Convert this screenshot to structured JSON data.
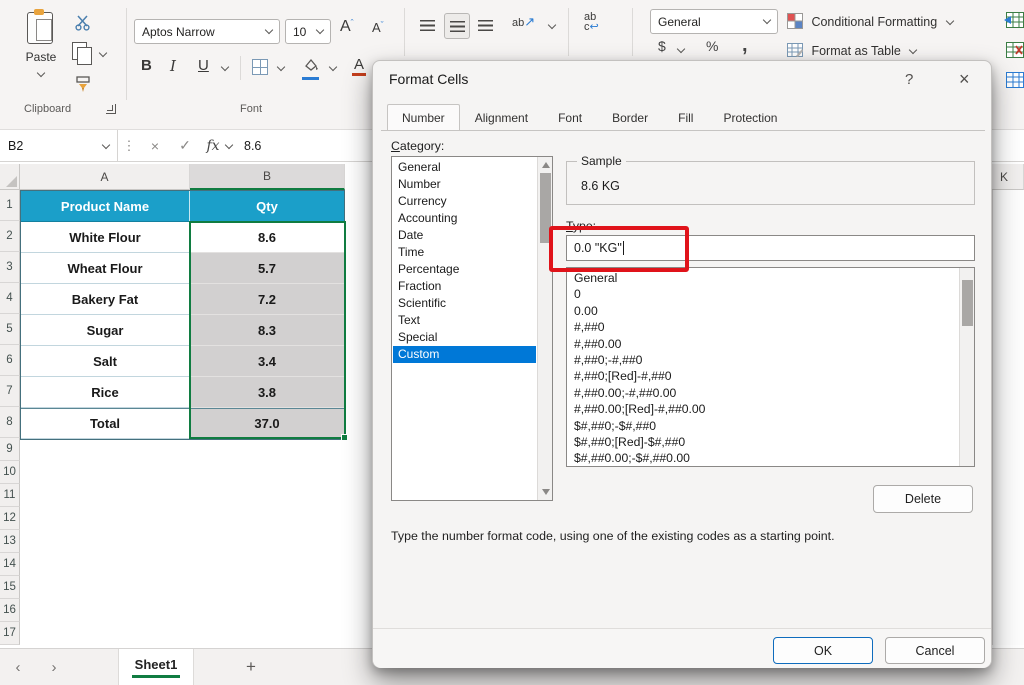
{
  "ribbon": {
    "clipboard": {
      "paste": "Paste",
      "group": "Clipboard"
    },
    "font": {
      "name": "Aptos Narrow",
      "size": "10",
      "grow": "A",
      "shrink": "A",
      "bold": "B",
      "italic": "I",
      "underline": "U",
      "font_color": "A",
      "group": "Font"
    },
    "alignment": {
      "orientation_glyph": "ab",
      "orientation_arrow": "↗",
      "wrap_top": "ab",
      "wrap_bottom": "c",
      "wrap_arrow": "↩"
    },
    "number": {
      "format": "General",
      "currency": "$",
      "percent": "%",
      "comma": ","
    },
    "styles": {
      "conditional_formatting": "Conditional Formatting",
      "format_as_table": "Format as Table"
    }
  },
  "formula_bar": {
    "name_box": "B2",
    "dots": "⋮",
    "cancel_glyph": "×",
    "enter_glyph": "✓",
    "fx": "fx",
    "value": "8.6"
  },
  "sheet": {
    "columns": {
      "a": "A",
      "b": "B",
      "far": "K"
    },
    "row_numbers": [
      "1",
      "2",
      "3",
      "4",
      "5",
      "6",
      "7",
      "8",
      "9",
      "10",
      "11",
      "12",
      "13",
      "14",
      "15",
      "16",
      "17"
    ],
    "table": {
      "header": [
        "Product Name",
        "Qty"
      ],
      "rows": [
        {
          "name": "White Flour",
          "qty": "8.6"
        },
        {
          "name": "Wheat Flour",
          "qty": "5.7"
        },
        {
          "name": "Bakery Fat",
          "qty": "7.2"
        },
        {
          "name": "Sugar",
          "qty": "8.3"
        },
        {
          "name": "Salt",
          "qty": "3.4"
        },
        {
          "name": "Rice",
          "qty": "3.8"
        },
        {
          "name": "Total",
          "qty": "37.0"
        }
      ]
    },
    "tab_bar": {
      "prev": "‹",
      "next": "›",
      "sheet": "Sheet1",
      "add": "+"
    }
  },
  "dialog": {
    "title": "Format Cells",
    "help_glyph": "?",
    "close_glyph": "×",
    "tabs": [
      "Number",
      "Alignment",
      "Font",
      "Border",
      "Fill",
      "Protection"
    ],
    "active_tab": "Number",
    "category_label": "Category:",
    "categories": [
      "General",
      "Number",
      "Currency",
      "Accounting",
      "Date",
      "Time",
      "Percentage",
      "Fraction",
      "Scientific",
      "Text",
      "Special",
      "Custom"
    ],
    "selected_category": "Custom",
    "sample_label": "Sample",
    "sample_value": "8.6 KG",
    "type_label": "Type:",
    "type_value": "0.0 \"KG\"",
    "format_codes": [
      "General",
      "0",
      "0.00",
      "#,##0",
      "#,##0.00",
      "#,##0;-#,##0",
      "#,##0;[Red]-#,##0",
      "#,##0.00;-#,##0.00",
      "#,##0.00;[Red]-#,##0.00",
      "$#,##0;-$#,##0",
      "$#,##0;[Red]-$#,##0",
      "$#,##0.00;-$#,##0.00"
    ],
    "delete_label": "Delete",
    "help_text": "Type the number format code, using one of the existing codes as a starting point.",
    "ok_label": "OK",
    "cancel_label": "Cancel"
  },
  "colors": {
    "table_header_teal": "#1B9FC9",
    "selection_fill_gray": "#D2D0D0",
    "selection_border_green": "#107C41",
    "list_selection_blue": "#0078D7",
    "annotation_red": "#E0131A",
    "accent_blue": "#0F6CBD"
  }
}
